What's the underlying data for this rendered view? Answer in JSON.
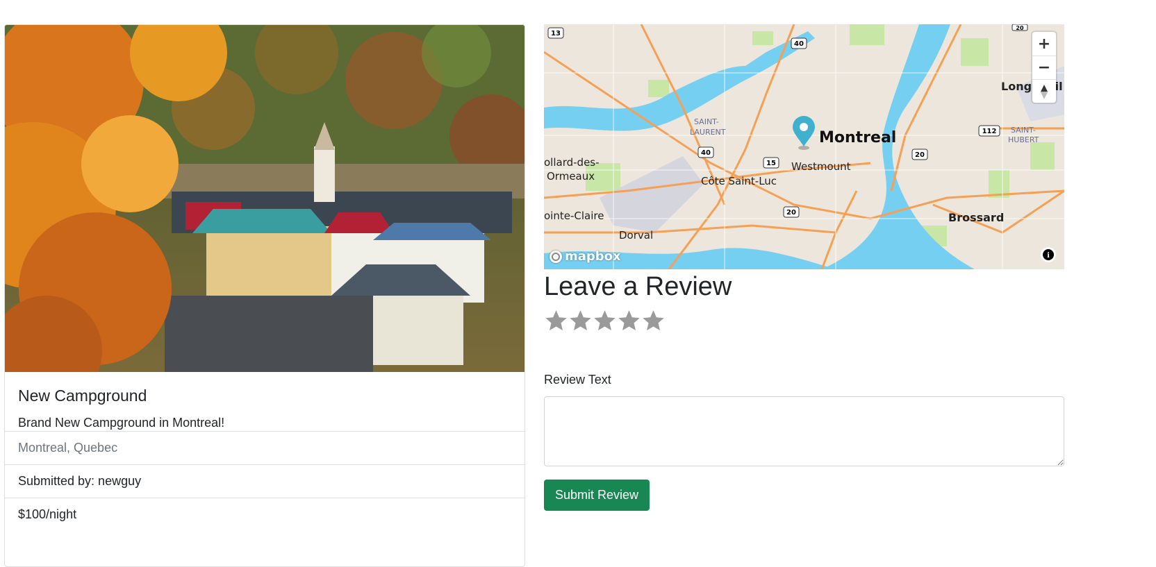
{
  "campground": {
    "title": "New Campground",
    "description": "Brand New Campground in Montreal!",
    "location": "Montreal, Quebec",
    "submitted_by": "Submitted by: newguy",
    "price": "$100/night",
    "image_alt": "Autumn village with colorful roofs"
  },
  "map": {
    "provider": "mapbox",
    "marker_city": "Montreal",
    "places": [
      "Longueuil",
      "SAINT-",
      "HUBERT",
      "SAINT-",
      "LAURENT",
      "ollard-des-",
      "Ormeaux",
      "Westmount",
      "Côte Saint-Luc",
      "ointe-Claire",
      "Dorval",
      "Brossard"
    ],
    "route_shields": [
      "13",
      "40",
      "40",
      "15",
      "20",
      "20",
      "112",
      "20"
    ],
    "controls": {
      "zoom_in": "+",
      "zoom_out": "−",
      "compass": "▲"
    },
    "info": "i",
    "colors": {
      "land": "#ede6dc",
      "water": "#75cff0",
      "highway": "#f5a055",
      "park": "#c8e6a5",
      "marker": "#3fb1ce"
    }
  },
  "review": {
    "heading": "Leave a Review",
    "rating_max": 5,
    "rating_value": 0,
    "text_label": "Review Text",
    "text_value": "",
    "submit_label": "Submit Review"
  },
  "colors": {
    "submit": "#198754",
    "star": "#9a9a9a"
  }
}
